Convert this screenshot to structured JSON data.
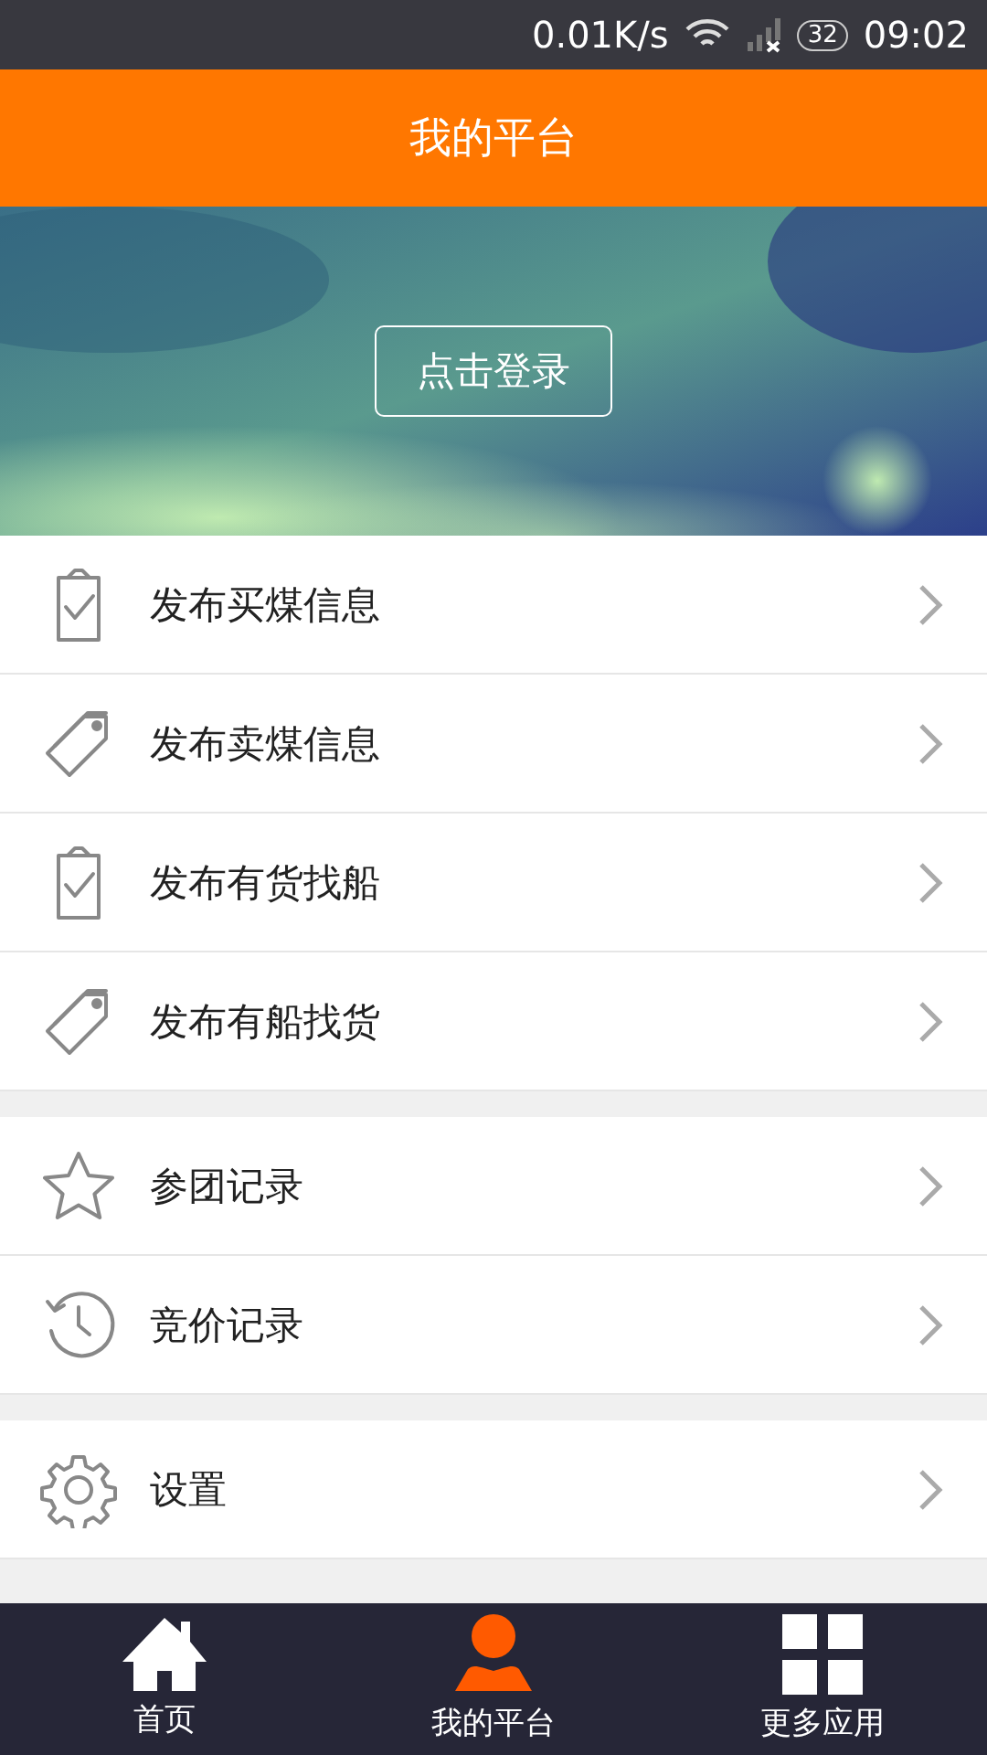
{
  "status_bar": {
    "speed": "0.01K/s",
    "battery": "32",
    "time": "09:02"
  },
  "header": {
    "title": "我的平台"
  },
  "banner": {
    "login_button": "点击登录"
  },
  "groups": [
    {
      "items": [
        {
          "label": "发布买煤信息"
        },
        {
          "label": "发布卖煤信息"
        },
        {
          "label": "发布有货找船"
        },
        {
          "label": "发布有船找货"
        }
      ]
    },
    {
      "items": [
        {
          "label": "参团记录"
        },
        {
          "label": "竞价记录"
        }
      ]
    },
    {
      "items": [
        {
          "label": "设置"
        }
      ]
    }
  ],
  "tab_bar": [
    {
      "label": "首页",
      "selected": false
    },
    {
      "label": "我的平台",
      "selected": true
    },
    {
      "label": "更多应用",
      "selected": false
    }
  ]
}
